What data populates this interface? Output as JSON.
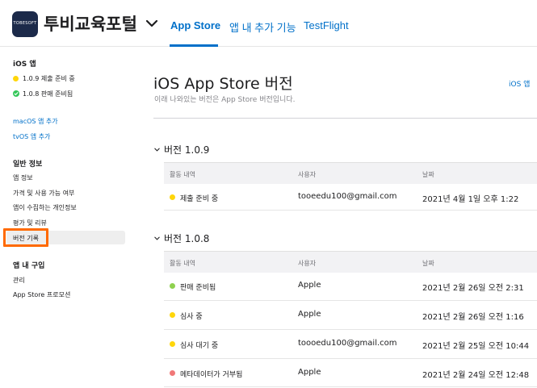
{
  "header": {
    "app_icon_text": "TOBESOFT",
    "app_name": "투비교육포털",
    "tabs": [
      {
        "label": "App Store",
        "active": true
      },
      {
        "label": "앱 내 추가 기능",
        "active": false
      },
      {
        "label": "TestFlight",
        "active": false
      }
    ]
  },
  "sidebar": {
    "ios_section": {
      "heading": "iOS 앱",
      "items": [
        {
          "label": "1.0.9 제출 준비 중",
          "status_color": "#ffd60a",
          "icon": "yellow-dot-icon"
        },
        {
          "label": "1.0.8 판매 준비됨",
          "status_color": "#34c759",
          "icon": "green-check-icon"
        }
      ]
    },
    "platform_links": [
      "macOS 앱 추가",
      "tvOS 앱 추가"
    ],
    "general_section": {
      "heading": "일반 정보",
      "items": [
        "앱 정보",
        "가격 및 사용 가능 여부",
        "앱이 수집하는 개인정보",
        "평가 및 리뷰",
        "버전 기록"
      ],
      "selected": "버전 기록"
    },
    "iap_section": {
      "heading": "앱 내 구입",
      "items": [
        "관리",
        "App Store 프로모션"
      ]
    }
  },
  "main": {
    "title": "iOS App Store 버전",
    "subtitle": "이래 나와있는 버전은 App Store 버전입니다.",
    "ios_link": "iOS 앱",
    "columns": [
      "활동 내역",
      "사용자",
      "날짜"
    ],
    "versions": [
      {
        "label": "버전 1.0.9",
        "rows": [
          {
            "status": "제출 준비 중",
            "dot_color": "#ffd60a",
            "user": "tooeedu100@gmail.com",
            "date": "2021년 4월 1일 오후 1:22"
          }
        ]
      },
      {
        "label": "버전 1.0.8",
        "rows": [
          {
            "status": "판매 준비됨",
            "dot_color": "#8fd14f",
            "user": "Apple",
            "date": "2021년 2월 26일 오전 2:31"
          },
          {
            "status": "심사 중",
            "dot_color": "#ffd60a",
            "user": "Apple",
            "date": "2021년 2월 26일 오전 1:16"
          },
          {
            "status": "심사 대기 중",
            "dot_color": "#ffd60a",
            "user": "toooedu100@gmail.com",
            "date": "2021년 2월 25일 오전 10:44"
          },
          {
            "status": "메타데이터가 거부됨",
            "dot_color": "#f07878",
            "user": "Apple",
            "date": "2021년 2월 24일 오전 12:48"
          }
        ]
      }
    ]
  },
  "colors": {
    "accent": "#0070c9",
    "highlight_box": "#ff6a00"
  }
}
